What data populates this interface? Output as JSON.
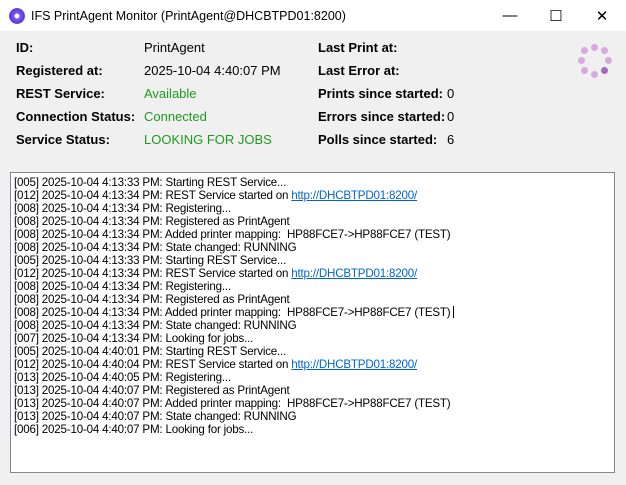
{
  "window": {
    "title": "IFS PrintAgent Monitor (PrintAgent@DHCBTPD01:8200)",
    "minimize": "—",
    "maximize": "☐",
    "close": "✕"
  },
  "left": [
    {
      "label": "ID:",
      "value": "PrintAgent",
      "status": false
    },
    {
      "label": "Registered at:",
      "value": "2025-10-04 4:40:07 PM",
      "status": false
    },
    {
      "label": "REST Service:",
      "value": "Available",
      "status": true
    },
    {
      "label": "Connection Status:",
      "value": "Connected",
      "status": true
    },
    {
      "label": "Service Status:",
      "value": "LOOKING FOR JOBS",
      "status": true
    }
  ],
  "right": [
    {
      "label": "Last Print at:",
      "value": ""
    },
    {
      "label": "Last Error at:",
      "value": ""
    },
    {
      "label": "Prints since started:",
      "value": "0"
    },
    {
      "label": "Errors since started:",
      "value": "0"
    },
    {
      "label": "Polls since started:",
      "value": "6"
    }
  ],
  "colors": {
    "status_green": "#1f9a1f",
    "link": "#0066cc"
  },
  "log": [
    {
      "text": "[005] 2025-10-04 4:13:33 PM: Starting REST Service..."
    },
    {
      "text": "[012] 2025-10-04 4:13:34 PM: REST Service started on ",
      "link": "http://DHCBTPD01:8200/"
    },
    {
      "text": "[008] 2025-10-04 4:13:34 PM: Registering..."
    },
    {
      "text": "[008] 2025-10-04 4:13:34 PM: Registered as PrintAgent"
    },
    {
      "text": "[008] 2025-10-04 4:13:34 PM: Added printer mapping:  HP88FCE7->HP88FCE7 (TEST)"
    },
    {
      "text": "[008] 2025-10-04 4:13:34 PM: State changed: RUNNING"
    },
    {
      "text": "[005] 2025-10-04 4:13:33 PM: Starting REST Service..."
    },
    {
      "text": "[012] 2025-10-04 4:13:34 PM: REST Service started on ",
      "link": "http://DHCBTPD01:8200/"
    },
    {
      "text": "[008] 2025-10-04 4:13:34 PM: Registering..."
    },
    {
      "text": "[008] 2025-10-04 4:13:34 PM: Registered as PrintAgent"
    },
    {
      "text": "[008] 2025-10-04 4:13:34 PM: Added printer mapping:  HP88FCE7->HP88FCE7 (TEST)",
      "caret": true
    },
    {
      "text": "[008] 2025-10-04 4:13:34 PM: State changed: RUNNING"
    },
    {
      "text": "[007] 2025-10-04 4:13:34 PM: Looking for jobs..."
    },
    {
      "text": "[005] 2025-10-04 4:40:01 PM: Starting REST Service..."
    },
    {
      "text": "[012] 2025-10-04 4:40:04 PM: REST Service started on ",
      "link": "http://DHCBTPD01:8200/"
    },
    {
      "text": "[013] 2025-10-04 4:40:05 PM: Registering..."
    },
    {
      "text": "[013] 2025-10-04 4:40:07 PM: Registered as PrintAgent"
    },
    {
      "text": "[013] 2025-10-04 4:40:07 PM: Added printer mapping:  HP88FCE7->HP88FCE7 (TEST)"
    },
    {
      "text": "[013] 2025-10-04 4:40:07 PM: State changed: RUNNING"
    },
    {
      "text": "[006] 2025-10-04 4:40:07 PM: Looking for jobs..."
    }
  ]
}
